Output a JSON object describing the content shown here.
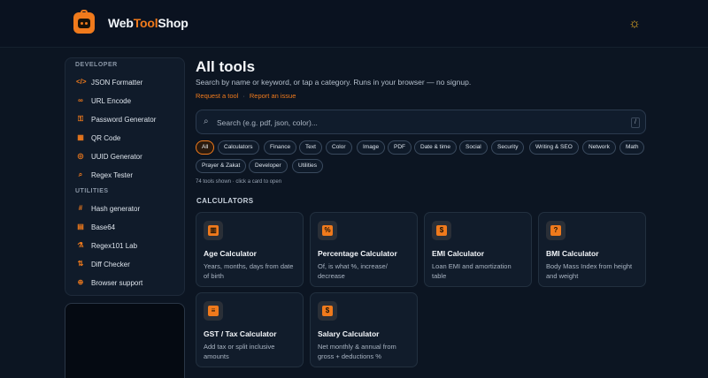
{
  "header": {
    "brand_prefix": "Web",
    "brand_mid": "Tool",
    "brand_suffix": "Shop",
    "theme_icon": "sun-icon"
  },
  "sidebar": {
    "developer_heading": "DEVELOPER",
    "developer_items": [
      {
        "label": "JSON Formatter",
        "icon": "code-icon"
      },
      {
        "label": "URL Encode",
        "icon": "link-icon"
      },
      {
        "label": "Password Generator",
        "icon": "key-icon"
      },
      {
        "label": "QR Code",
        "icon": "qr-icon"
      },
      {
        "label": "UUID Generator",
        "icon": "fingerprint-icon"
      },
      {
        "label": "Regex Tester",
        "icon": "search-icon"
      }
    ],
    "utilities_heading": "UTILITIES",
    "utility_items": [
      {
        "label": "Hash generator",
        "icon": "hash-icon"
      },
      {
        "label": "Base64",
        "icon": "file-icon"
      },
      {
        "label": "Regex101 Lab",
        "icon": "flask-icon"
      },
      {
        "label": "Diff Checker",
        "icon": "diff-icon"
      },
      {
        "label": "Browser support",
        "icon": "globe-icon"
      }
    ]
  },
  "main": {
    "title": "All tools",
    "subtitle": "Search by name or keyword, or tap a category. Runs in your browser — no signup.",
    "request_link": "Request a tool",
    "report_link": "Report an issue",
    "search_placeholder": "Search (e.g. pdf, json, color)...",
    "search_shortcut": "/",
    "categories": [
      "All",
      "Calculators",
      "Finance",
      "Text",
      "Color",
      "Image",
      "PDF",
      "Date & time",
      "Social",
      "Security",
      "Writing & SEO",
      "Network",
      "Math",
      "Prayer & Zakat",
      "Developer",
      "Utilities"
    ],
    "active_category": "All",
    "count_text": "74 tools shown · click a card to open",
    "section_heading": "CALCULATORS",
    "cards": [
      {
        "title": "Age Calculator",
        "desc": "Years, months, days from date of birth",
        "icon": "cake-icon"
      },
      {
        "title": "Percentage Calculator",
        "desc": "Of, is what %, increase/ decrease",
        "icon": "percent-icon"
      },
      {
        "title": "EMI Calculator",
        "desc": "Loan EMI and amortization table",
        "icon": "money-icon"
      },
      {
        "title": "BMI Calculator",
        "desc": "Body Mass Index from height and weight",
        "icon": "scale-icon"
      },
      {
        "title": "GST / Tax Calculator",
        "desc": "Add tax or split inclusive amounts",
        "icon": "receipt-icon"
      },
      {
        "title": "Salary Calculator",
        "desc": "Net monthly & annual from gross + deductions %",
        "icon": "money-bag-icon"
      }
    ]
  }
}
